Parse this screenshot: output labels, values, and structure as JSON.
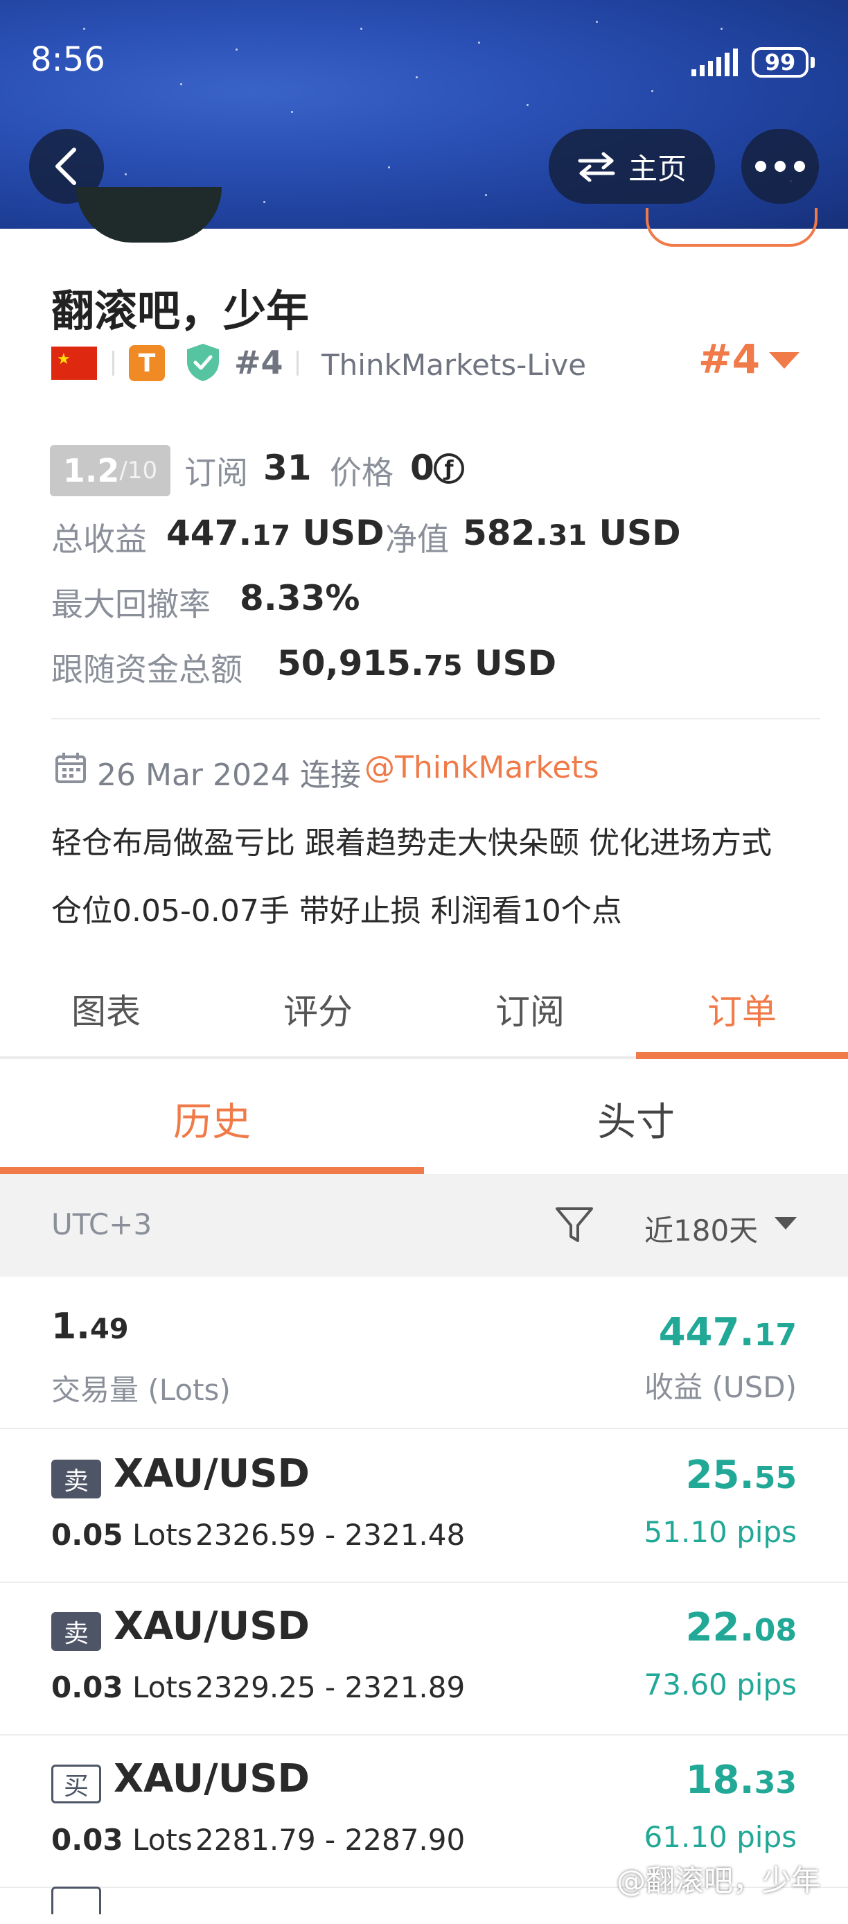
{
  "status_bar": {
    "time": "8:56",
    "battery": "99"
  },
  "header": {
    "home_label": "主页"
  },
  "profile": {
    "name": "翻滚吧，少年",
    "tag_letter": "T",
    "rank_small": "#4",
    "broker": "ThinkMarkets-Live",
    "rank_big": "#4",
    "score_value": "1.2",
    "score_max": "/10",
    "subscribe_label": "订阅",
    "subscribe_count": "31",
    "price_label": "价格",
    "price_value": "0",
    "coin_symbol": "ƒ",
    "revenue_label": "总收益",
    "revenue_int": "447.",
    "revenue_dec": "17",
    "revenue_unit": " USD",
    "equity_label": "净值",
    "equity_int": "582.",
    "equity_dec": "31",
    "equity_unit": " USD",
    "drawdown_label": "最大回撤率",
    "drawdown_value": "8.33%",
    "funds_label": "跟随资金总额",
    "funds_int": "50,915.",
    "funds_dec": "75",
    "funds_unit": " USD",
    "connect_text": "26 Mar 2024 连接",
    "broker_link": "@ThinkMarkets",
    "bio_line_1": "轻仓布局做盈亏比 跟着趋势走大快朵颐 优化进场方式",
    "bio_line_2": "仓位0.05-0.07手 带好止损 利润看10个点"
  },
  "main_tabs": [
    "图表",
    "评分",
    "订阅",
    "订单"
  ],
  "sub_tabs": [
    "历史",
    "头寸"
  ],
  "filter": {
    "timezone": "UTC+3",
    "period": "近180天"
  },
  "summary": {
    "volume_int": "1.",
    "volume_dec": "49",
    "volume_label": "交易量 (Lots)",
    "profit_int": "447.",
    "profit_dec": "17",
    "profit_label": "收益 (USD)"
  },
  "trades": [
    {
      "side": "卖",
      "symbol": "XAU/USD",
      "lots": "0.05",
      "lots_unit": " Lots",
      "range": "2326.59 - 2321.48",
      "profit_int": "25.",
      "profit_dec": "55",
      "pips": "51.10 pips"
    },
    {
      "side": "卖",
      "symbol": "XAU/USD",
      "lots": "0.03",
      "lots_unit": " Lots",
      "range": "2329.25 - 2321.89",
      "profit_int": "22.",
      "profit_dec": "08",
      "pips": "73.60 pips"
    },
    {
      "side": "买",
      "symbol": "XAU/USD",
      "lots": "0.03",
      "lots_unit": " Lots",
      "range": "2281.79 - 2287.90",
      "profit_int": "18.",
      "profit_dec": "33",
      "pips": "61.10 pips"
    }
  ],
  "watermark": "@翻滚吧，少年",
  "colors": {
    "accent": "#f07a48",
    "profit": "#21a896",
    "header_blue": "#2a50b5"
  },
  "icons": [
    "back-arrow-icon",
    "swap-arrows-icon",
    "more-dots-icon",
    "china-flag-icon",
    "verified-shield-icon",
    "calendar-icon",
    "filter-funnel-icon",
    "caret-down-icon",
    "signal-icon",
    "battery-icon"
  ]
}
